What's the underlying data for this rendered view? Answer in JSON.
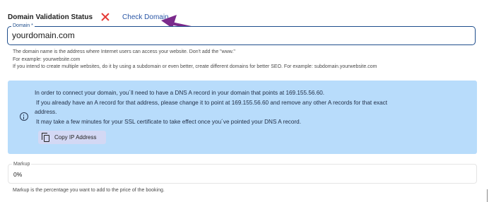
{
  "status": {
    "label": "Domain Validation Status",
    "icon": "close-icon",
    "icon_color": "#e53935",
    "action_link": "Check Domain"
  },
  "domain_field": {
    "label": "Domain *",
    "value": "yourdomain.com",
    "helper_lines": [
      "The domain name is the address where Internet users can access your website. Don't add the \"www.\"",
      "For example: yourwebsite.com",
      "If you intend to create multiple websites, do it by using a subdomain or even better, create different domains for better SEO. For example: subdomain.yourwebsite.com"
    ]
  },
  "info_alert": {
    "icon": "info-icon",
    "lines": [
      "In order to connect your domain, you´ll need to have a DNS A record in your domain that points at 169.155.56.60.",
      "If you already have an A record for that address, please change it to point at 169.155.56.60 and remove any other A records for that exact",
      "address.",
      "It may take a few minutes for your SSL certificate to take effect once you´ve pointed your DNS A record."
    ],
    "copy_button": {
      "icon": "copy-icon",
      "label": "Copy IP Address"
    },
    "background_color": "#b8dcfb"
  },
  "markup_field": {
    "label": "Markup",
    "value": "0%",
    "helper": "Markup is the percentage you want to add to the price of the booking."
  },
  "annotation": {
    "arrow_color": "#7b2a8c"
  }
}
